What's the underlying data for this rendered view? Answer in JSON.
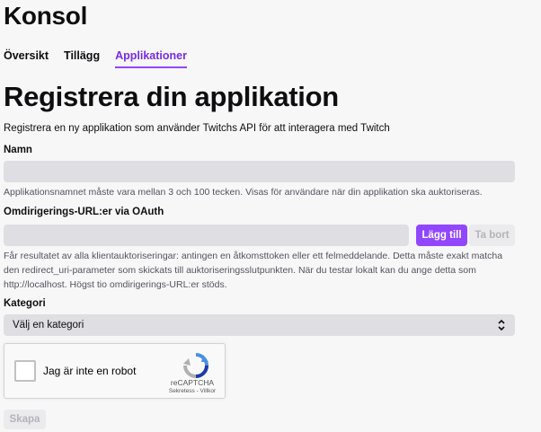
{
  "header": {
    "title": "Konsol",
    "tabs": [
      {
        "label": "Översikt",
        "active": false
      },
      {
        "label": "Tillägg",
        "active": false
      },
      {
        "label": "Applikationer",
        "active": true
      }
    ]
  },
  "form": {
    "title": "Registrera din applikation",
    "subtitle": "Registrera en ny applikation som använder Twitchs API för att interagera med Twitch",
    "name": {
      "label": "Namn",
      "value": "",
      "help": "Applikationsnamnet måste vara mellan 3 och 100 tecken. Visas för användare när din applikation ska auktoriseras."
    },
    "redirect": {
      "label": "Omdirigerings-URL:er via OAuth",
      "value": "",
      "add_label": "Lägg till",
      "remove_label": "Ta bort",
      "help_lines": [
        "Får resultatet av alla klientauktoriseringar: antingen en åtkomsttoken eller ett felmeddelande. Detta måste exakt matcha",
        "den redirect_uri-parameter som skickats till auktoriseringsslutpunkten. När du testar lokalt kan du ange detta som",
        "http://localhost. Högst tio omdirigerings-URL:er stöds."
      ]
    },
    "category": {
      "label": "Kategori",
      "selected": "Välj en kategori"
    },
    "captcha": {
      "text": "Jag är inte en robot",
      "brand": "reCAPTCHA",
      "links": "Sekretess - Villkor",
      "icon": "recaptcha-logo"
    },
    "submit_label": "Skapa"
  },
  "colors": {
    "accent": "#9147ff",
    "active_tab": "#772ce8",
    "input_bg": "#dedee3",
    "disabled_text": "#b3b3ba"
  }
}
